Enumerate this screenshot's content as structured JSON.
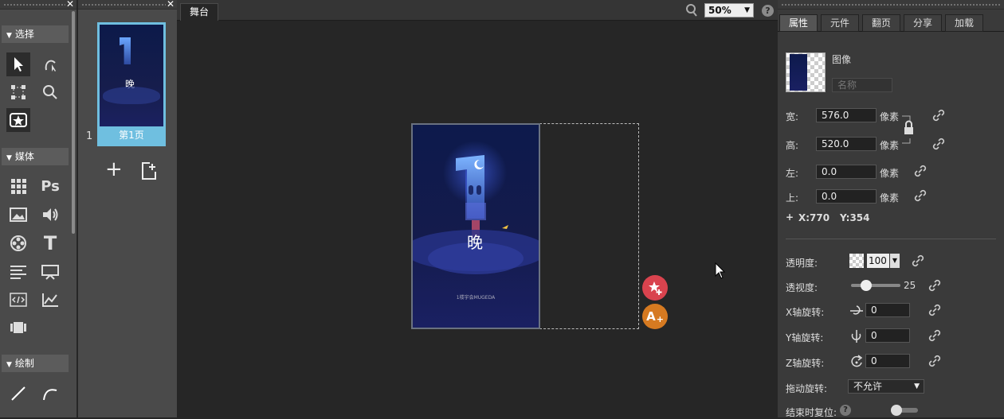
{
  "tools": {
    "sections": {
      "select": "选择",
      "media": "媒体",
      "draw": "绘制"
    },
    "media_ps_label": "Ps",
    "media_text_label": "T"
  },
  "pages": {
    "page_number": "1",
    "thumb_label": "第1页",
    "thumb_char": "晚",
    "add_symbol": "+"
  },
  "stage": {
    "tab_label": "舞台",
    "zoom_value": "50%",
    "help": "?",
    "artwork": {
      "big_char": "晚",
      "footer": "1楼宇会MUGEDA"
    },
    "fab_add_text": "A"
  },
  "properties": {
    "tabs": [
      "属性",
      "元件",
      "翻页",
      "分享",
      "加载"
    ],
    "type_label": "图像",
    "name_placeholder": "名称",
    "width_label": "宽:",
    "width_value": "576.0",
    "height_label": "高:",
    "height_value": "520.0",
    "left_label": "左:",
    "left_value": "0.0",
    "top_label": "上:",
    "top_value": "0.0",
    "unit": "像素",
    "coord_prefix": "+",
    "x_coord": "X:770",
    "y_coord": "Y:354",
    "opacity_label": "透明度:",
    "opacity_value": "100",
    "perspective_label": "透视度:",
    "perspective_value": "25",
    "perspective_level": 0.3,
    "x_rot_label": "X轴旋转:",
    "x_rot_value": "0",
    "y_rot_label": "Y轴旋转:",
    "y_rot_value": "0",
    "z_rot_label": "Z轴旋转:",
    "z_rot_value": "0",
    "drag_label": "拖动旋转:",
    "drag_value": "不允许",
    "reset_label": "结束时复位:",
    "reset_help": "?"
  },
  "colors": {
    "accent_tab": "#6fbfe0",
    "fab_red": "#d9434e",
    "fab_orange": "#d67a21"
  }
}
